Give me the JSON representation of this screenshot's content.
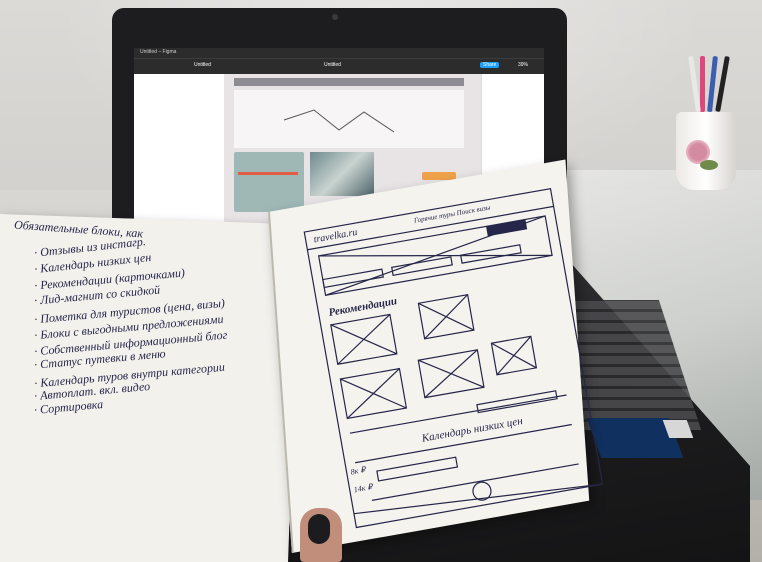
{
  "scene": {
    "description_keys": [
      "laptop",
      "notebook",
      "cup",
      "pens"
    ]
  },
  "laptop": {
    "window_title": "Untitled – Figma",
    "tab_title": "Untitled",
    "file_title": "Untitled",
    "share_label": "Share",
    "zoom_label": "39%"
  },
  "notebook_left": {
    "heading": "Обязательные блоки, как",
    "items": [
      "· Отзывы из инстагр.",
      "· Календарь низких цен",
      "· Рекомендации (карточками)",
      "· Лид-магнит со скидкой",
      "· Пометка для туристов (цена, визы)",
      "· Блоки с выгодными предложениями",
      "· Собственный информационный блог",
      "· Статус путевки в меню",
      "· Календарь туров внутри категории",
      "· Автоплат. вкл. видео",
      "· Сортировка"
    ]
  },
  "notebook_right": {
    "site_name": "travelka.ru",
    "header_note": "Горячие туры  Поиск визы",
    "recommendations_label": "Рекомендации",
    "calendar_label": "Календарь низких цен",
    "price_labels": [
      "8к ₽",
      "14к ₽"
    ]
  },
  "colors": {
    "ink": "#25264a",
    "figma_dark": "#2c2c2c",
    "accent_orange": "#f0a24a",
    "card_teal": "#9fb8b6"
  }
}
